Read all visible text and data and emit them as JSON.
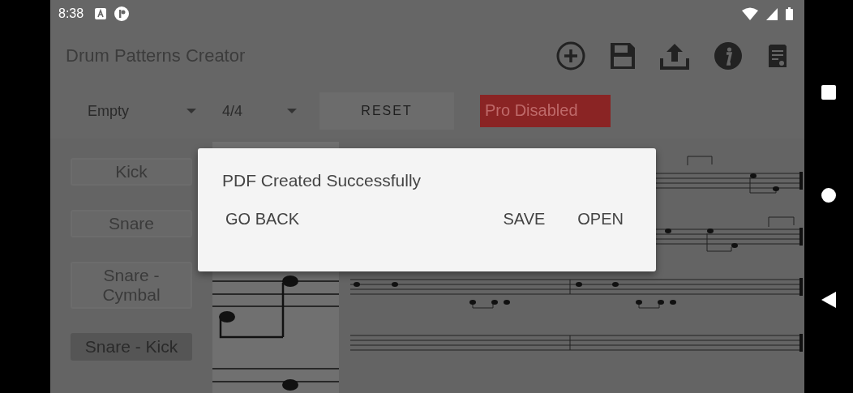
{
  "status_bar": {
    "time": "8:38"
  },
  "app_bar": {
    "title": "Drum Patterns Creator"
  },
  "controls": {
    "pattern_dropdown": {
      "value": "Empty"
    },
    "time_signature_dropdown": {
      "value": "4/4"
    },
    "reset_button": {
      "label": "RESET"
    },
    "pro_badge": {
      "label": "Pro Disabled"
    }
  },
  "pads": [
    {
      "label": "Kick",
      "selected": false
    },
    {
      "label": "Snare",
      "selected": false
    },
    {
      "label": "Snare - Cymbal",
      "selected": false
    },
    {
      "label": "Snare - Kick",
      "selected": true
    }
  ],
  "dialog": {
    "title": "PDF Created Successfully",
    "buttons": [
      {
        "label": "GO BACK",
        "kind": "left"
      },
      {
        "label": "SAVE",
        "kind": "right"
      },
      {
        "label": "OPEN",
        "kind": "right"
      }
    ]
  }
}
